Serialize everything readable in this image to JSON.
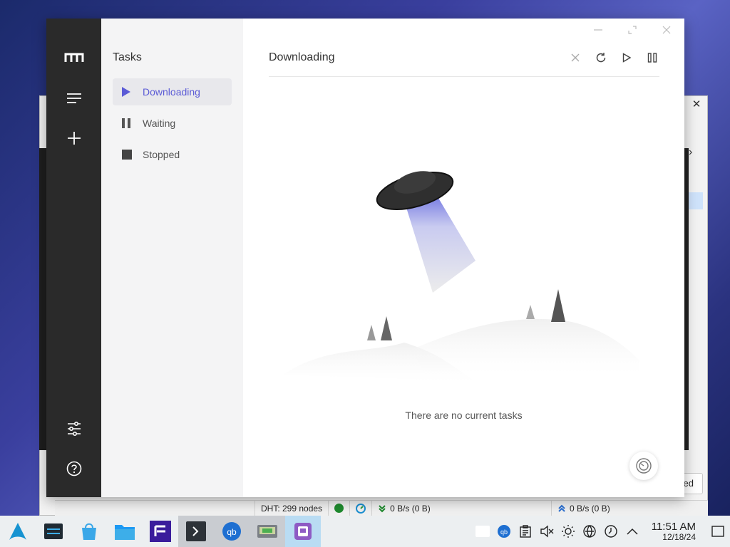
{
  "sidebar": {
    "title": "Tasks",
    "items": [
      {
        "label": "Downloading",
        "icon": "play-icon",
        "active": true
      },
      {
        "label": "Waiting",
        "icon": "pause-icon",
        "active": false
      },
      {
        "label": "Stopped",
        "icon": "stop-icon",
        "active": false
      }
    ]
  },
  "rail": {
    "icons": [
      "motrix-logo-icon",
      "menu-icon",
      "plus-icon",
      "settings-sliders-icon",
      "help-icon"
    ]
  },
  "main": {
    "title": "Downloading",
    "actions": [
      "close-icon",
      "refresh-icon",
      "play-icon",
      "pause-icon"
    ],
    "empty_message": "There are no current tasks"
  },
  "background_app": {
    "button_partial": "ed",
    "status": {
      "dht": "DHT: 299 nodes",
      "download": "0 B/s (0 B)",
      "upload": "0 B/s (0 B)"
    }
  },
  "taskbar": {
    "time": "11:51 AM",
    "date": "12/18/24"
  },
  "colors": {
    "accent": "#5b5bd6",
    "rail": "#2a2a2a",
    "panel": "#f4f4f5"
  }
}
